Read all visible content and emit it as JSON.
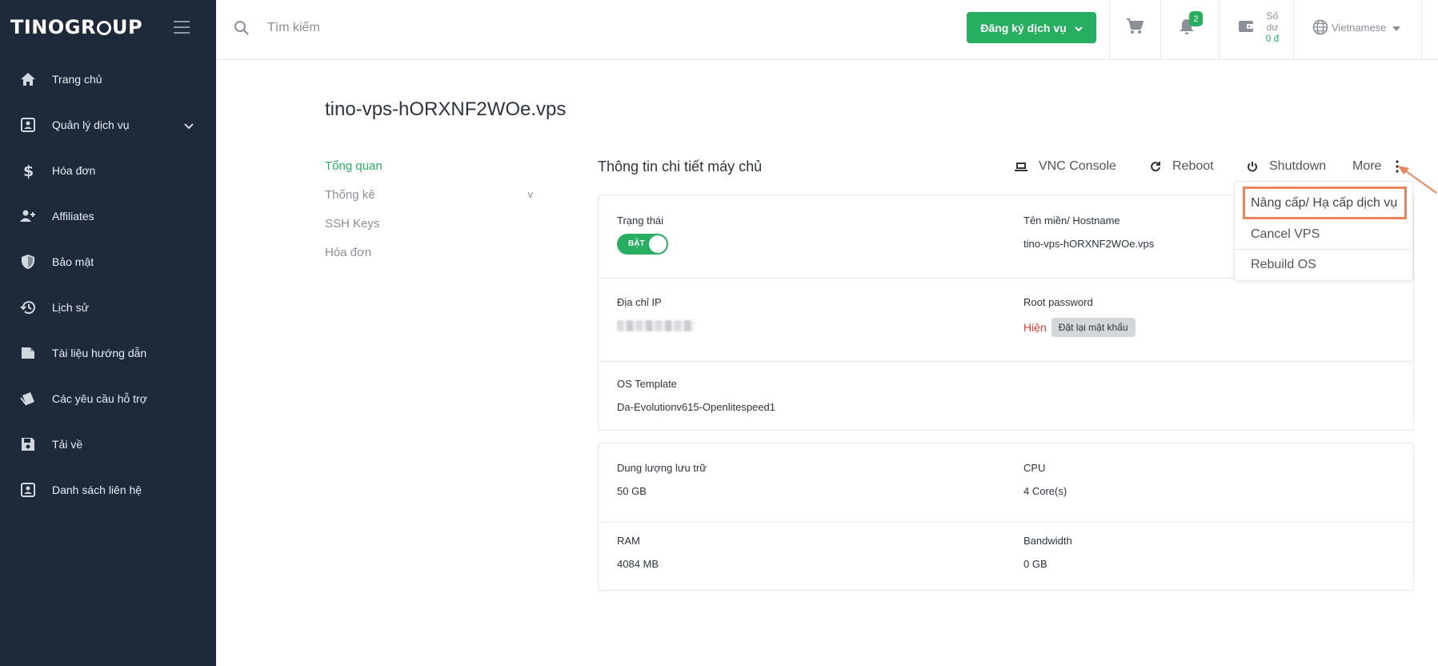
{
  "brand": {
    "name_part1": "TINOGR",
    "name_part2": "UP"
  },
  "sidebar": {
    "items": [
      {
        "label": "Trang chủ",
        "icon": "home-icon"
      },
      {
        "label": "Quản lý dịch vụ",
        "icon": "account-box-icon",
        "has_children": true
      },
      {
        "label": "Hóa đơn",
        "icon": "dollar-icon"
      },
      {
        "label": "Affiliates",
        "icon": "people-add-icon"
      },
      {
        "label": "Bảo mật",
        "icon": "shield-icon"
      },
      {
        "label": "Lịch sử",
        "icon": "history-icon"
      },
      {
        "label": "Tài liệu hướng dẫn",
        "icon": "document-icon"
      },
      {
        "label": "Các yêu cầu hỗ trợ",
        "icon": "ticket-icon"
      },
      {
        "label": "Tải về",
        "icon": "save-icon"
      },
      {
        "label": "Danh sách liên hệ",
        "icon": "contact-icon"
      }
    ]
  },
  "topbar": {
    "search_placeholder": "Tìm kiếm",
    "register_label": "Đăng ký dịch vụ",
    "notification_count": "2",
    "balance_label_1": "Số",
    "balance_label_2": "dư",
    "balance_amount": "0 đ",
    "language": "Vietnamese"
  },
  "page": {
    "title": "tino-vps-hORXNF2WOe.vps",
    "subnav": [
      {
        "label": "Tổng quan",
        "active": true
      },
      {
        "label": "Thống kê",
        "expand": "v"
      },
      {
        "label": "SSH Keys"
      },
      {
        "label": "Hóa đơn"
      }
    ],
    "section_title": "Thông tin chi tiết máy chủ",
    "actions": {
      "vnc": "VNC Console",
      "reboot": "Reboot",
      "shutdown": "Shutdown",
      "more": "More"
    },
    "dropdown": [
      "Nâng cấp/ Hạ cấp dịch vụ",
      "Cancel VPS",
      "Rebuild OS"
    ]
  },
  "details": {
    "status_label": "Trạng thái",
    "status_toggle": "BẬT",
    "hostname_label": "Tên miền/ Hostname",
    "hostname_value": "tino-vps-hORXNF2WOe.vps",
    "ip_label": "Địa chỉ IP",
    "root_label": "Root password",
    "root_show": "Hiện",
    "root_reset": "Đặt lại mật khẩu",
    "os_label": "OS Template",
    "os_value": "Da-Evolutionv615-Openlitespeed1"
  },
  "resources": {
    "storage_label": "Dung lượng lưu trữ",
    "storage_value": "50 GB",
    "cpu_label": "CPU",
    "cpu_value": "4 Core(s)",
    "ram_label": "RAM",
    "ram_value": "4084 MB",
    "bandwidth_label": "Bandwidth",
    "bandwidth_value": "0 GB"
  },
  "colors": {
    "sidebar_bg": "#1e2a3a",
    "accent": "#27ae60",
    "highlight": "#e9855a",
    "danger": "#e53935"
  }
}
